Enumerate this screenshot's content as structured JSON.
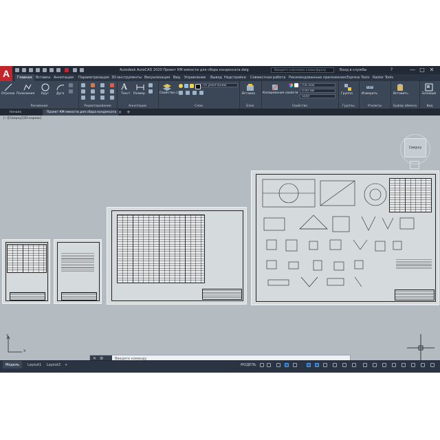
{
  "app": {
    "logo_letter": "A",
    "title": "Autodesk AutoCAD 2020   Проект КМ емкости для сбора конденсата.dwg",
    "search_placeholder": "Введите ключевое слово/фразу",
    "signin": "Вход в службы",
    "help": "?",
    "win": {
      "min": "—",
      "max": "□",
      "close": "✕"
    }
  },
  "ribbon_tabs": [
    "Главная",
    "Вставка",
    "Аннотации",
    "Параметризация",
    "3D-инструменты",
    "Визуализация",
    "Вид",
    "Управление",
    "Вывод",
    "Надстройки",
    "Совместная работа",
    "Рекомендованные приложения",
    "Express Tools",
    "Raster Tools"
  ],
  "ribbon": {
    "draw": {
      "title": "Рисование",
      "line": "Отрезок",
      "polyline": "Полилиния",
      "circle": "Круг",
      "arc": "Дуга"
    },
    "modify": {
      "title": "Редактирование"
    },
    "annotation": {
      "title": "Аннотации",
      "text": "Текст",
      "dimension": "Размер"
    },
    "layers": {
      "title": "Слои",
      "layer_props": "Свойства слоя",
      "current_layer": "По умолчанию"
    },
    "block": {
      "title": "Блок",
      "insert": "Вставка"
    },
    "properties": {
      "title": "Свойства",
      "match": "Копирование свойств",
      "color": "ПоСлою",
      "lineweight": "0.00 мм",
      "linetype": "Solid"
    },
    "groups": {
      "title": "Группы",
      "group": "Группа"
    },
    "utilities": {
      "title": "Утилиты",
      "measure": "Измерить"
    },
    "clipboard": {
      "title": "Буфер обмена",
      "paste": "Вставить"
    },
    "view": {
      "title": "Вид",
      "base": "Базовый"
    }
  },
  "doc_tabs": {
    "start": "Начало",
    "drawing": "Проект КМ емкости для сбора конденсата",
    "close": "×",
    "add": "+"
  },
  "viewport": {
    "label": "[−][Сверху][2D-каркас]",
    "viewcube": "Сверху",
    "ucs_y": "Y",
    "ucs_x": "X",
    "command_placeholder": "Введите команду"
  },
  "status": {
    "model": "МОДЕЛЬ",
    "tabs": [
      "Модель",
      "Layout1",
      "Layout2"
    ],
    "add": "+"
  }
}
